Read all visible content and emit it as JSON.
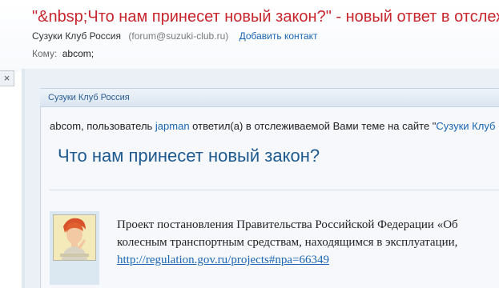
{
  "message": {
    "subject": "\"&nbsp;Что нам принесет новый закон?\" - новый ответ в отслеживаемой теме",
    "from_name": "Сузуки Клуб Россия",
    "from_email": "(forum@suzuki-club.ru)",
    "add_contact": "Добавить контакт",
    "to_label": "Кому:",
    "to_value": "abcom;"
  },
  "toolbar": {
    "close_glyph": "×"
  },
  "email_body": {
    "site_name": "Сузуки Клуб Россия",
    "notice_prefix": "abcom, пользователь ",
    "notice_user": "japman",
    "notice_middle": " ответил(а) в отслеживаемой Вами теме на сайте \"",
    "notice_site": "Сузуки Клуб Россия",
    "topic_title": "Что нам принесет новый закон?",
    "post_line_1": "Проект постановления Правительства Российской Федерации «Об",
    "post_line_2": "колесным транспортным средствам, находящимся в эксплуатации,",
    "post_link": "http://regulation.gov.ru/projects#npa=66349"
  },
  "colors": {
    "subject": "#c8262d",
    "link": "#1a66b3",
    "title": "#1e5a8e"
  }
}
